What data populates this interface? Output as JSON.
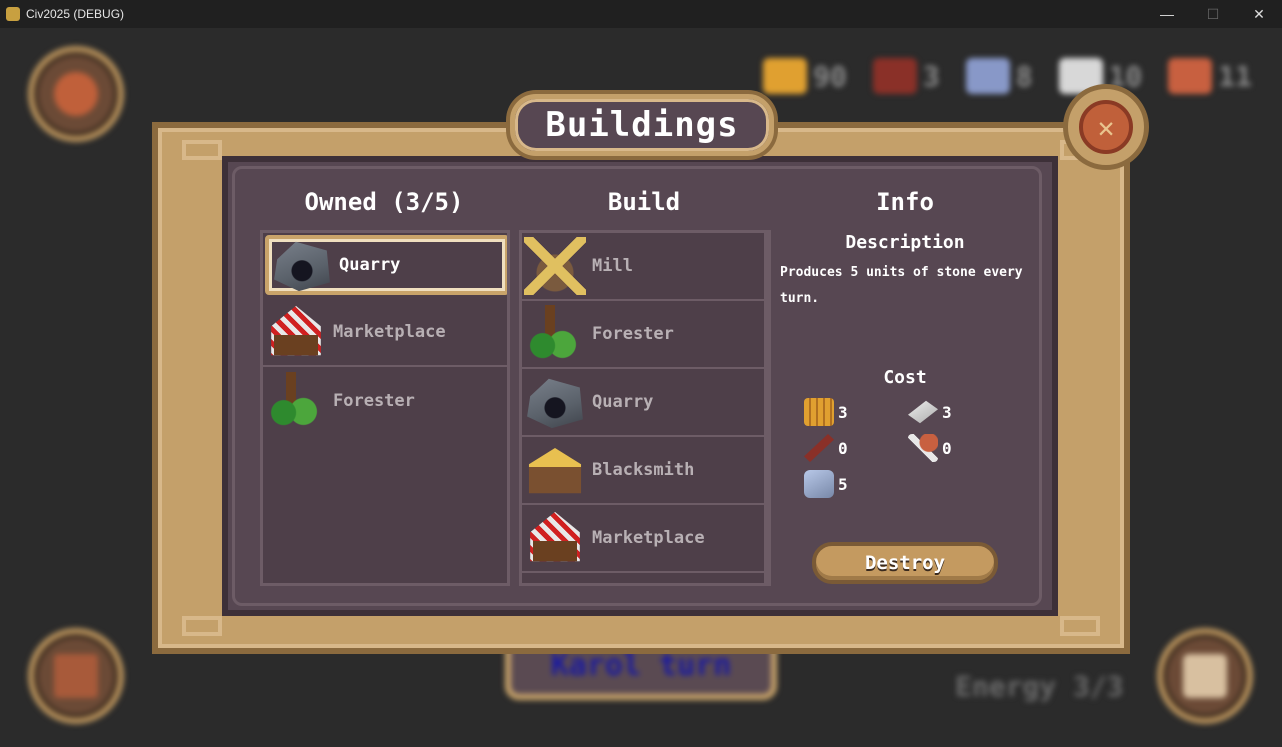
{
  "window": {
    "title": "Civ2025 (DEBUG)",
    "minimize": "—",
    "maximize": "☐",
    "close": "✕"
  },
  "hud": {
    "resources": [
      {
        "name": "gold",
        "value": "90",
        "color": "#e0a030"
      },
      {
        "name": "wood",
        "value": "3",
        "color": "#8a3028"
      },
      {
        "name": "stone",
        "value": "8",
        "color": "#8898c8"
      },
      {
        "name": "iron",
        "value": "10",
        "color": "#d8d8d8"
      },
      {
        "name": "food",
        "value": "11",
        "color": "#c86040"
      }
    ],
    "turn_label": "Karol turn",
    "energy_label": "Energy 3/3"
  },
  "modal": {
    "title": "Buildings",
    "owned_header": "Owned (3/5)",
    "build_header": "Build",
    "info_header": "Info",
    "owned": [
      {
        "name": "Quarry",
        "icon": "quarry-icon",
        "selected": true
      },
      {
        "name": "Marketplace",
        "icon": "marketplace-icon",
        "selected": false
      },
      {
        "name": "Forester",
        "icon": "forester-icon",
        "selected": false
      }
    ],
    "build": [
      {
        "name": "Mill",
        "icon": "mill-icon"
      },
      {
        "name": "Forester",
        "icon": "forester-icon"
      },
      {
        "name": "Quarry",
        "icon": "quarry-icon"
      },
      {
        "name": "Blacksmith",
        "icon": "blacksmith-icon"
      },
      {
        "name": "Marketplace",
        "icon": "marketplace-icon"
      }
    ],
    "info": {
      "description_label": "Description",
      "description": "Produces 5 units of stone every turn.",
      "cost_label": "Cost",
      "cost": {
        "gold": "3",
        "iron": "3",
        "wood": "0",
        "food": "0",
        "stone": "5"
      },
      "destroy_label": "Destroy"
    }
  },
  "colors": {
    "frame": "#c4a06a",
    "panel": "#574752",
    "accent": "#c0603a"
  }
}
